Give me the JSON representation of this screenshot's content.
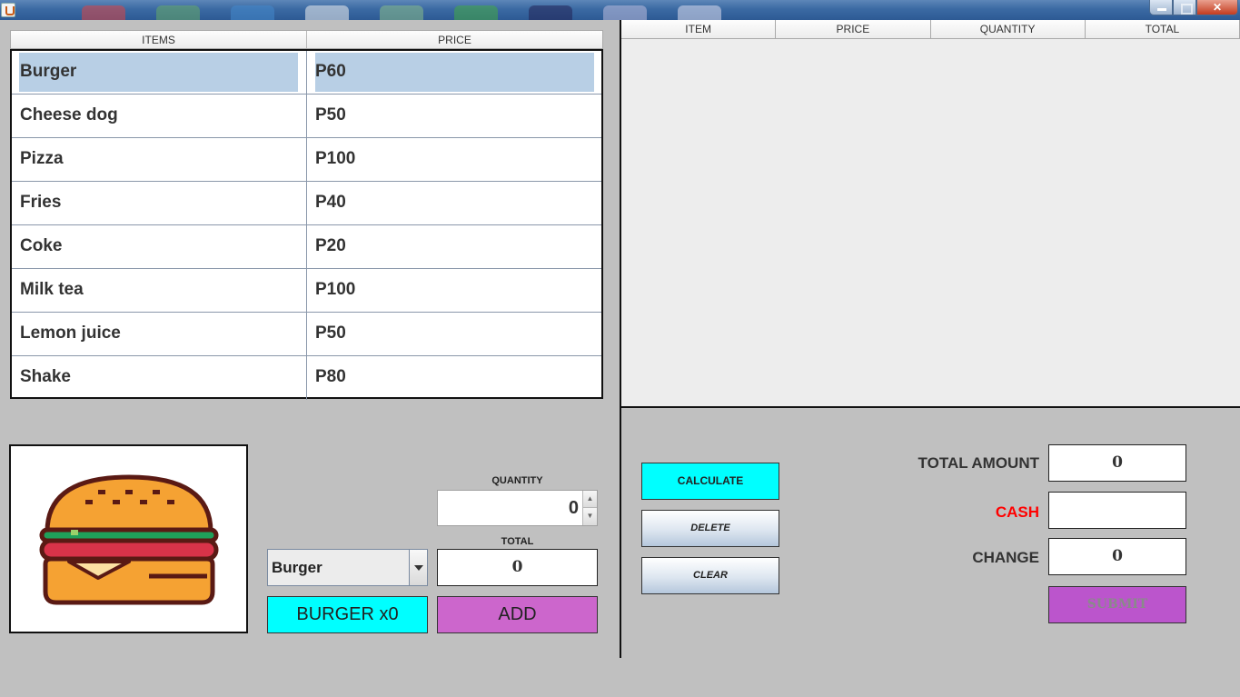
{
  "titlebar": {
    "buttons": [
      "minimize",
      "maximize",
      "close"
    ],
    "close_glyph": "✕"
  },
  "menu": {
    "headers": [
      "ITEMS",
      "PRICE"
    ],
    "rows": [
      {
        "item": "Burger",
        "price": "P60"
      },
      {
        "item": "Cheese dog",
        "price": "P50"
      },
      {
        "item": "Pizza",
        "price": "P100"
      },
      {
        "item": "Fries",
        "price": "P40"
      },
      {
        "item": "Coke",
        "price": "P20"
      },
      {
        "item": "Milk tea",
        "price": "P100"
      },
      {
        "item": "Lemon juice",
        "price": "P50"
      },
      {
        "item": "Shake",
        "price": "P80"
      }
    ],
    "selected_index": 0
  },
  "order": {
    "headers": [
      "ITEM",
      "PRICE",
      "QUANTITY",
      "TOTAL"
    ]
  },
  "item_image": {
    "icon": "burger-icon"
  },
  "controls": {
    "quantity_label": "QUANTITY",
    "quantity_value": "0",
    "total_label": "TOTAL",
    "total_value": "0",
    "combo_value": "Burger",
    "summary_button": "BURGER x0",
    "add_button": "ADD"
  },
  "actions": {
    "calculate": "CALCULATE",
    "delete": "DELETE",
    "clear": "CLEAR"
  },
  "payment": {
    "total_amount_label": "TOTAL AMOUNT",
    "total_amount_value": "0",
    "cash_label": "CASH",
    "cash_value": "",
    "change_label": "CHANGE",
    "change_value": "0",
    "submit_button": "SUBMIT"
  },
  "colors": {
    "cyan": "#00ffff",
    "purple_add": "#cc66cc",
    "purple_submit": "#bb55cc",
    "cash_red": "#ff0000",
    "selection": "#b8cfe5"
  }
}
